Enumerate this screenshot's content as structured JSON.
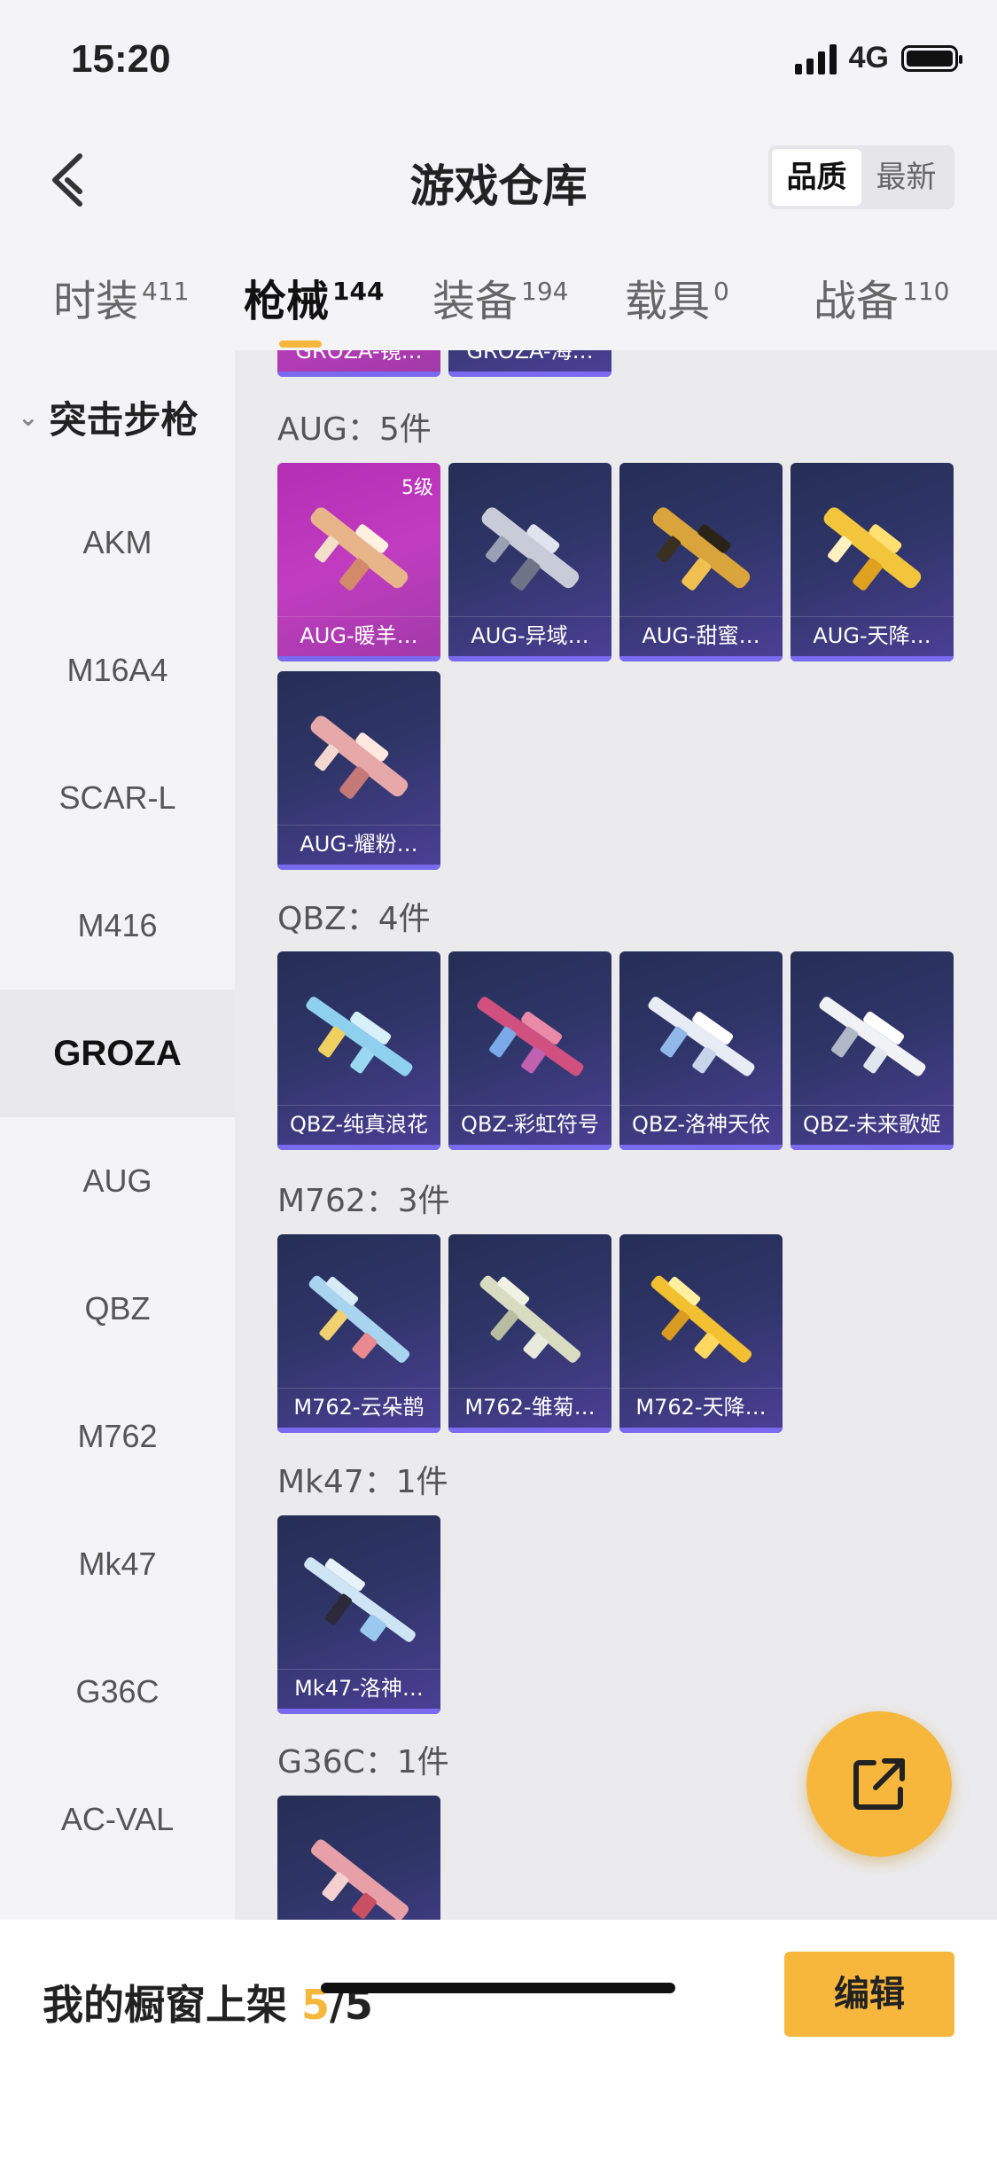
{
  "status": {
    "time": "15:20",
    "network": "4G"
  },
  "header": {
    "title": "游戏仓库",
    "sort": [
      "品质",
      "最新"
    ]
  },
  "tabs": [
    {
      "label": "时装",
      "count": "411"
    },
    {
      "label": "枪械",
      "count": "144"
    },
    {
      "label": "装备",
      "count": "194"
    },
    {
      "label": "载具",
      "count": "0"
    },
    {
      "label": "战备",
      "count": "110"
    }
  ],
  "sidebar": {
    "category": "突击步枪",
    "items": [
      "AKM",
      "M16A4",
      "SCAR-L",
      "M416",
      "GROZA",
      "AUG",
      "QBZ",
      "M762",
      "Mk47",
      "G36C",
      "AC-VAL"
    ],
    "active": "GROZA"
  },
  "groups": [
    {
      "label": "",
      "items": [
        "GROZA-镜…",
        "GROZA-海…"
      ]
    },
    {
      "label": "AUG：5件",
      "items": [
        "AUG-暖羊…",
        "AUG-异域…",
        "AUG-甜蜜…",
        "AUG-天降…",
        "AUG-耀粉…"
      ],
      "first_level": "5级"
    },
    {
      "label": "QBZ：4件",
      "items": [
        "QBZ-纯真浪花",
        "QBZ-彩虹符号",
        "QBZ-洛神天依",
        "QBZ-未来歌姬"
      ]
    },
    {
      "label": "M762：3件",
      "items": [
        "M762-云朵鹊",
        "M762-雏菊…",
        "M762-天降…"
      ]
    },
    {
      "label": "Mk47：1件",
      "items": [
        "Mk47-洛神…"
      ]
    },
    {
      "label": "G36C：1件",
      "items": [
        ""
      ]
    }
  ],
  "colors": {
    "accent": "#f6b73c",
    "card_dark": "#2f3568",
    "card_pink": "#c03cc0",
    "card_border": "#7a6af0"
  },
  "bottom": {
    "showcase_label": "我的橱窗上架",
    "showcase_count": "5",
    "showcase_total": "/5",
    "edit_label": "编辑"
  },
  "fab_icon": "share-external-icon"
}
